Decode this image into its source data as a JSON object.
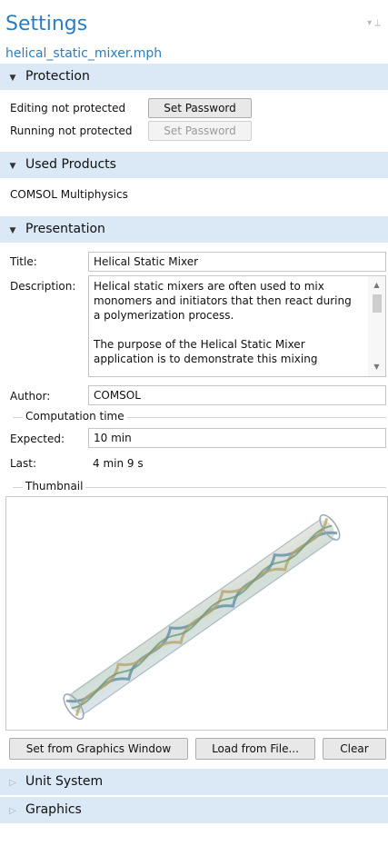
{
  "header": {
    "title": "Settings",
    "subtitle": "helical_static_mixer.mph"
  },
  "protection": {
    "section_label": "Protection",
    "editing_label": "Editing not protected",
    "running_label": "Running not protected",
    "set_password_label": "Set Password"
  },
  "used_products": {
    "section_label": "Used Products",
    "product": "COMSOL Multiphysics"
  },
  "presentation": {
    "section_label": "Presentation",
    "title_label": "Title:",
    "title_value": "Helical Static Mixer",
    "description_label": "Description:",
    "description_p1": "Helical static mixers are often used to mix monomers and initiators that then react during a polymerization process.",
    "description_p2": "The purpose of the Helical Static Mixer application is to demonstrate this mixing",
    "author_label": "Author:",
    "author_value": "COMSOL",
    "computation_time_label": "Computation time",
    "expected_label": "Expected:",
    "expected_value": "10 min",
    "last_label": "Last:",
    "last_value": "4 min 9 s",
    "thumbnail_label": "Thumbnail"
  },
  "thumbnail_buttons": {
    "set_from_graphics": "Set from Graphics Window",
    "load_from_file": "Load from File...",
    "clear": "Clear"
  },
  "collapsed_sections": {
    "unit_system": "Unit System",
    "graphics": "Graphics"
  },
  "icons": [
    "pin-icon",
    "triangle-down-icon",
    "triangle-right-icon",
    "scroll-up-icon",
    "scroll-down-icon"
  ]
}
